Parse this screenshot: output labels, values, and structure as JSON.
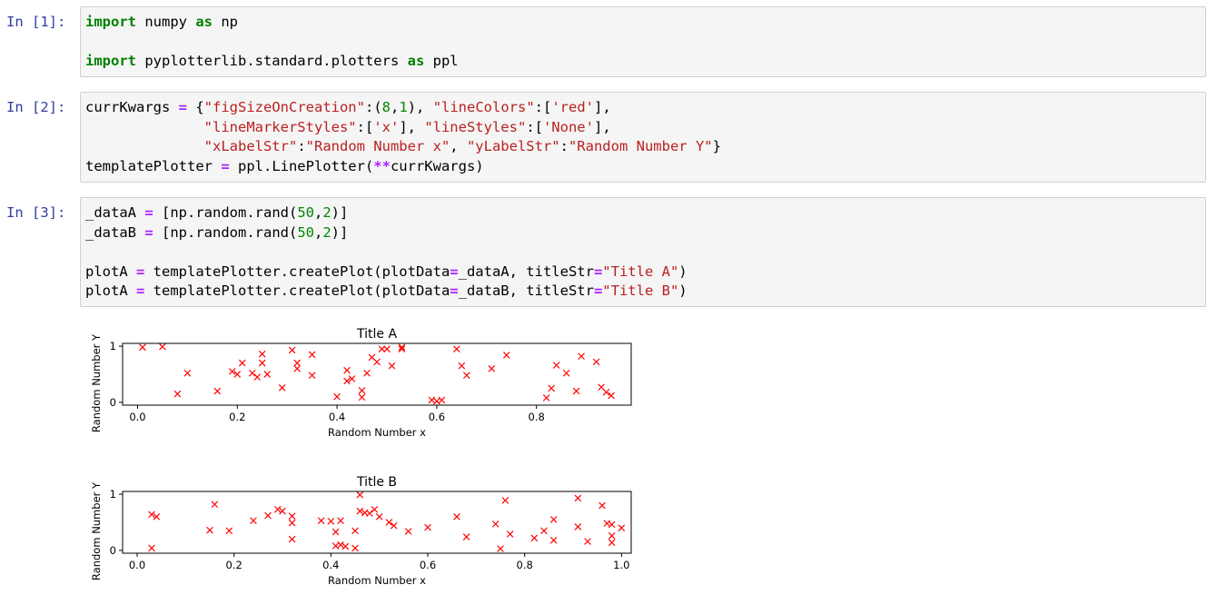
{
  "cells": [
    {
      "prompt": "In [1]:",
      "lines": [
        [
          [
            "kw",
            "import"
          ],
          [
            "t",
            " numpy "
          ],
          [
            "kw",
            "as"
          ],
          [
            "t",
            " np"
          ]
        ],
        [],
        [
          [
            "kw",
            "import"
          ],
          [
            "t",
            " pyplotterlib.standard.plotters "
          ],
          [
            "kw",
            "as"
          ],
          [
            "t",
            " ppl"
          ]
        ]
      ]
    },
    {
      "prompt": "In [2]:",
      "lines": [
        [
          [
            "t",
            "currKwargs "
          ],
          [
            "op",
            "="
          ],
          [
            "t",
            " {"
          ],
          [
            "str",
            "\"figSizeOnCreation\""
          ],
          [
            "t",
            ":("
          ],
          [
            "num",
            "8"
          ],
          [
            "t",
            ","
          ],
          [
            "num",
            "1"
          ],
          [
            "t",
            "), "
          ],
          [
            "str",
            "\"lineColors\""
          ],
          [
            "t",
            ":["
          ],
          [
            "str",
            "'red'"
          ],
          [
            "t",
            "],"
          ]
        ],
        [
          [
            "t",
            "              "
          ],
          [
            "str",
            "\"lineMarkerStyles\""
          ],
          [
            "t",
            ":["
          ],
          [
            "str",
            "'x'"
          ],
          [
            "t",
            "], "
          ],
          [
            "str",
            "\"lineStyles\""
          ],
          [
            "t",
            ":["
          ],
          [
            "str",
            "'None'"
          ],
          [
            "t",
            "],"
          ]
        ],
        [
          [
            "t",
            "              "
          ],
          [
            "str",
            "\"xLabelStr\""
          ],
          [
            "t",
            ":"
          ],
          [
            "str",
            "\"Random Number x\""
          ],
          [
            "t",
            ", "
          ],
          [
            "str",
            "\"yLabelStr\""
          ],
          [
            "t",
            ":"
          ],
          [
            "str",
            "\"Random Number Y\""
          ],
          [
            "t",
            "}"
          ]
        ],
        [
          [
            "t",
            "templatePlotter "
          ],
          [
            "op",
            "="
          ],
          [
            "t",
            " ppl.LinePlotter("
          ],
          [
            "op",
            "**"
          ],
          [
            "t",
            "currKwargs)"
          ]
        ]
      ]
    },
    {
      "prompt": "In [3]:",
      "lines": [
        [
          [
            "t",
            "_dataA "
          ],
          [
            "op",
            "="
          ],
          [
            "t",
            " [np.random.rand("
          ],
          [
            "num",
            "50"
          ],
          [
            "t",
            ","
          ],
          [
            "num",
            "2"
          ],
          [
            "t",
            ")]"
          ]
        ],
        [
          [
            "t",
            "_dataB "
          ],
          [
            "op",
            "="
          ],
          [
            "t",
            " [np.random.rand("
          ],
          [
            "num",
            "50"
          ],
          [
            "t",
            ","
          ],
          [
            "num",
            "2"
          ],
          [
            "t",
            ")]"
          ]
        ],
        [],
        [
          [
            "t",
            "plotA "
          ],
          [
            "op",
            "="
          ],
          [
            "t",
            " templatePlotter.createPlot(plotData"
          ],
          [
            "op",
            "="
          ],
          [
            "t",
            "_dataA, titleStr"
          ],
          [
            "op",
            "="
          ],
          [
            "str",
            "\"Title A\""
          ],
          [
            "t",
            ")"
          ]
        ],
        [
          [
            "t",
            "plotA "
          ],
          [
            "op",
            "="
          ],
          [
            "t",
            " templatePlotter.createPlot(plotData"
          ],
          [
            "op",
            "="
          ],
          [
            "t",
            "_dataB, titleStr"
          ],
          [
            "op",
            "="
          ],
          [
            "str",
            "\"Title B\""
          ],
          [
            "t",
            ")"
          ]
        ]
      ]
    }
  ],
  "chart_data": [
    {
      "type": "scatter",
      "title": "Title A",
      "xlabel": "Random Number x",
      "ylabel": "Random Number Y",
      "xlim": [
        -0.03,
        0.99
      ],
      "ylim": [
        -0.05,
        1.05
      ],
      "xticks": [
        0.0,
        0.2,
        0.4,
        0.6,
        0.8
      ],
      "xticklabels": [
        "0.0",
        "0.2",
        "0.4",
        "0.6",
        "0.8"
      ],
      "yticks": [
        0,
        1
      ],
      "yticklabels": [
        "0",
        "1"
      ],
      "marker": "x",
      "color": "#ff0000",
      "x": [
        0.01,
        0.05,
        0.08,
        0.1,
        0.16,
        0.19,
        0.2,
        0.21,
        0.23,
        0.24,
        0.25,
        0.25,
        0.26,
        0.29,
        0.31,
        0.32,
        0.32,
        0.35,
        0.35,
        0.4,
        0.42,
        0.42,
        0.43,
        0.45,
        0.45,
        0.46,
        0.47,
        0.48,
        0.49,
        0.5,
        0.51,
        0.53,
        0.53,
        0.59,
        0.6,
        0.61,
        0.64,
        0.65,
        0.66,
        0.71,
        0.74,
        0.82,
        0.83,
        0.84,
        0.86,
        0.88,
        0.89,
        0.92,
        0.93,
        0.94,
        0.95
      ],
      "y": [
        0.98,
        0.99,
        0.15,
        0.52,
        0.2,
        0.55,
        0.5,
        0.7,
        0.52,
        0.45,
        0.86,
        0.7,
        0.5,
        0.26,
        0.93,
        0.7,
        0.6,
        0.85,
        0.48,
        0.1,
        0.38,
        0.57,
        0.42,
        0.09,
        0.21,
        0.52,
        0.8,
        0.72,
        0.95,
        0.95,
        0.65,
        0.98,
        0.95,
        0.04,
        0.02,
        0.04,
        0.95,
        0.65,
        0.48,
        0.6,
        0.84,
        0.08,
        0.25,
        0.66,
        0.52,
        0.2,
        0.82,
        0.72,
        0.27,
        0.18,
        0.12
      ]
    },
    {
      "type": "scatter",
      "title": "Title B",
      "xlabel": "Random Number x",
      "ylabel": "Random Number Y",
      "xlim": [
        -0.03,
        1.02
      ],
      "ylim": [
        -0.05,
        1.05
      ],
      "xticks": [
        0.0,
        0.2,
        0.4,
        0.6,
        0.8,
        1.0
      ],
      "xticklabels": [
        "0.0",
        "0.2",
        "0.4",
        "0.6",
        "0.8",
        "1.0"
      ],
      "yticks": [
        0,
        1
      ],
      "yticklabels": [
        "0",
        "1"
      ],
      "marker": "x",
      "color": "#ff0000",
      "x": [
        0.03,
        0.03,
        0.04,
        0.15,
        0.16,
        0.19,
        0.24,
        0.27,
        0.29,
        0.3,
        0.32,
        0.32,
        0.32,
        0.38,
        0.4,
        0.41,
        0.41,
        0.42,
        0.42,
        0.43,
        0.45,
        0.45,
        0.46,
        0.46,
        0.47,
        0.48,
        0.49,
        0.5,
        0.52,
        0.53,
        0.56,
        0.6,
        0.66,
        0.68,
        0.74,
        0.75,
        0.76,
        0.77,
        0.82,
        0.84,
        0.86,
        0.86,
        0.91,
        0.91,
        0.93,
        0.96,
        0.97,
        0.98,
        0.98,
        0.98,
        1.0
      ],
      "y": [
        0.64,
        0.04,
        0.6,
        0.36,
        0.82,
        0.35,
        0.53,
        0.62,
        0.73,
        0.7,
        0.61,
        0.49,
        0.2,
        0.53,
        0.52,
        0.33,
        0.08,
        0.1,
        0.53,
        0.07,
        0.04,
        0.35,
        0.99,
        0.7,
        0.67,
        0.66,
        0.73,
        0.6,
        0.5,
        0.44,
        0.34,
        0.41,
        0.6,
        0.24,
        0.47,
        0.03,
        0.89,
        0.29,
        0.22,
        0.35,
        0.55,
        0.18,
        0.93,
        0.42,
        0.16,
        0.8,
        0.48,
        0.26,
        0.14,
        0.46,
        0.4
      ]
    }
  ]
}
